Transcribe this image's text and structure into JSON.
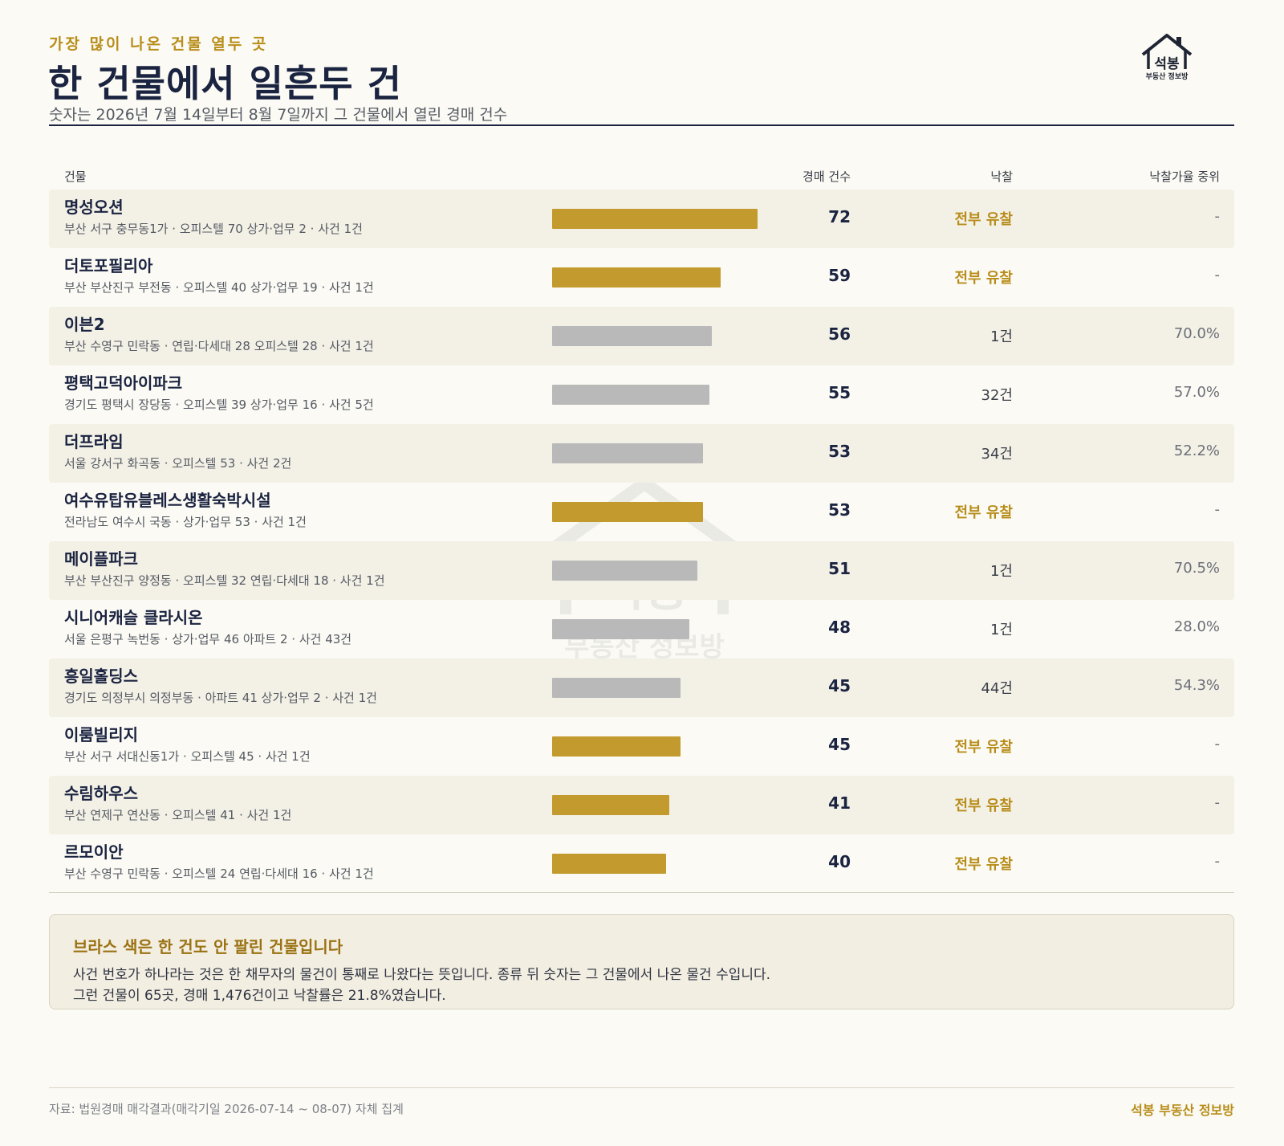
{
  "header": {
    "eyebrow": "가장 많이 나온 건물 열두 곳",
    "title": "한 건물에서 일흔두 건",
    "subtitle": "숫자는 2026년 7월 14일부터 8월 7일까지 그 건물에서 열린 경매 건수"
  },
  "logo": {
    "name": "석봉",
    "sub": "부동산 정보방",
    "icon": "house-icon"
  },
  "columns": {
    "building": "건물",
    "count": "경매 건수",
    "sold": "낙찰",
    "median": "낙찰가율 중위"
  },
  "colors": {
    "unsold_bar": "#c39a2d",
    "sold_bar": "#b9b9b9",
    "accent": "#b88d1a",
    "title": "#1a2340"
  },
  "chart_data": {
    "type": "bar",
    "orientation": "horizontal",
    "xlim": [
      0,
      72
    ],
    "rows": [
      {
        "name": "명성오션",
        "meta": "부산 서구 충무동1가 · 오피스텔 70 상가·업무 2 · 사건 1건",
        "count": 72,
        "sold": "전부 유찰",
        "all_unsold": true,
        "median": "-"
      },
      {
        "name": "더토포필리아",
        "meta": "부산 부산진구 부전동 · 오피스텔 40 상가·업무 19 · 사건 1건",
        "count": 59,
        "sold": "전부 유찰",
        "all_unsold": true,
        "median": "-"
      },
      {
        "name": "이븐2",
        "meta": "부산 수영구 민락동 · 연립·다세대 28 오피스텔 28 · 사건 1건",
        "count": 56,
        "sold": "1건",
        "all_unsold": false,
        "median": "70.0%"
      },
      {
        "name": "평택고덕아이파크",
        "meta": "경기도 평택시 장당동 · 오피스텔 39 상가·업무 16 · 사건 5건",
        "count": 55,
        "sold": "32건",
        "all_unsold": false,
        "median": "57.0%"
      },
      {
        "name": "더프라임",
        "meta": "서울 강서구 화곡동 · 오피스텔 53 · 사건 2건",
        "count": 53,
        "sold": "34건",
        "all_unsold": false,
        "median": "52.2%"
      },
      {
        "name": "여수유탑유블레스생활숙박시설",
        "meta": "전라남도 여수시 국동 · 상가·업무 53 · 사건 1건",
        "count": 53,
        "sold": "전부 유찰",
        "all_unsold": true,
        "median": "-"
      },
      {
        "name": "메이플파크",
        "meta": "부산 부산진구 양정동 · 오피스텔 32 연립·다세대 18 · 사건 1건",
        "count": 51,
        "sold": "1건",
        "all_unsold": false,
        "median": "70.5%"
      },
      {
        "name": "시니어캐슬 클라시온",
        "meta": "서울 은평구 녹번동 · 상가·업무 46 아파트 2 · 사건 43건",
        "count": 48,
        "sold": "1건",
        "all_unsold": false,
        "median": "28.0%"
      },
      {
        "name": "흥일홀딩스",
        "meta": "경기도 의정부시 의정부동 · 아파트 41 상가·업무 2 · 사건 1건",
        "count": 45,
        "sold": "44건",
        "all_unsold": false,
        "median": "54.3%"
      },
      {
        "name": "이룸빌리지",
        "meta": "부산 서구 서대신동1가 · 오피스텔 45 · 사건 1건",
        "count": 45,
        "sold": "전부 유찰",
        "all_unsold": true,
        "median": "-"
      },
      {
        "name": "수림하우스",
        "meta": "부산 연제구 연산동 · 오피스텔 41 · 사건 1건",
        "count": 41,
        "sold": "전부 유찰",
        "all_unsold": true,
        "median": "-"
      },
      {
        "name": "르모이안",
        "meta": "부산 수영구 민락동 · 오피스텔 24 연립·다세대 16 · 사건 1건",
        "count": 40,
        "sold": "전부 유찰",
        "all_unsold": true,
        "median": "-"
      }
    ]
  },
  "note": {
    "title": "브라스 색은 한 건도 안 팔린 건물입니다",
    "line1": "사건 번호가 하나라는 것은 한 채무자의 물건이 통째로 나왔다는 뜻입니다. 종류 뒤 숫자는 그 건물에서 나온 물건 수입니다.",
    "line2": "그런 건물이 65곳, 경매 1,476건이고 낙찰률은 21.8%였습니다."
  },
  "footer": {
    "source": "자료: 법원경매 매각결과(매각기일 2026-07-14 ~ 08-07) 자체 집계",
    "brand": "석봉 부동산 정보방"
  }
}
